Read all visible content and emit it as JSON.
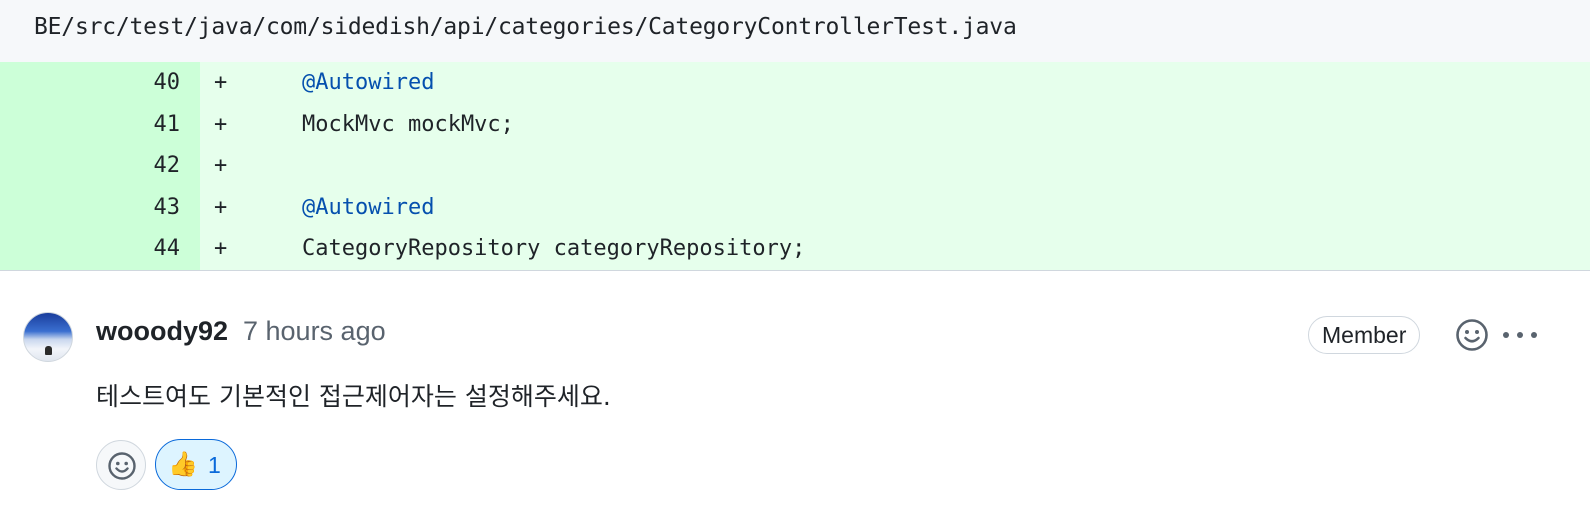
{
  "file": {
    "path": "BE/src/test/java/com/sidedish/api/categories/CategoryControllerTest.java"
  },
  "diff": {
    "lines": [
      {
        "number": "40",
        "marker": "+",
        "code": "@Autowired",
        "kind": "annotation"
      },
      {
        "number": "41",
        "marker": "+",
        "code": "MockMvc mockMvc;",
        "kind": "code"
      },
      {
        "number": "42",
        "marker": "+",
        "code": "",
        "kind": "code"
      },
      {
        "number": "43",
        "marker": "+",
        "code": "@Autowired",
        "kind": "annotation"
      },
      {
        "number": "44",
        "marker": "+",
        "code": "CategoryRepository categoryRepository;",
        "kind": "code"
      }
    ]
  },
  "comment": {
    "author": "wooody92",
    "timestamp": "7 hours ago",
    "role_badge": "Member",
    "body": "테스트여도 기본적인 접근제어자는 설정해주세요.",
    "icons": {
      "emoji": "smiley-icon",
      "more": "kebab-horizontal-icon"
    },
    "reactions": [
      {
        "emoji": "👍",
        "count": "1"
      }
    ]
  },
  "colors": {
    "added_line_bg": "#e6ffec",
    "added_number_bg": "#ccffd8",
    "annotation_text": "#0550ae",
    "reaction_accent": "#0969da",
    "muted_text": "#59636e",
    "border": "#d0d7de"
  }
}
